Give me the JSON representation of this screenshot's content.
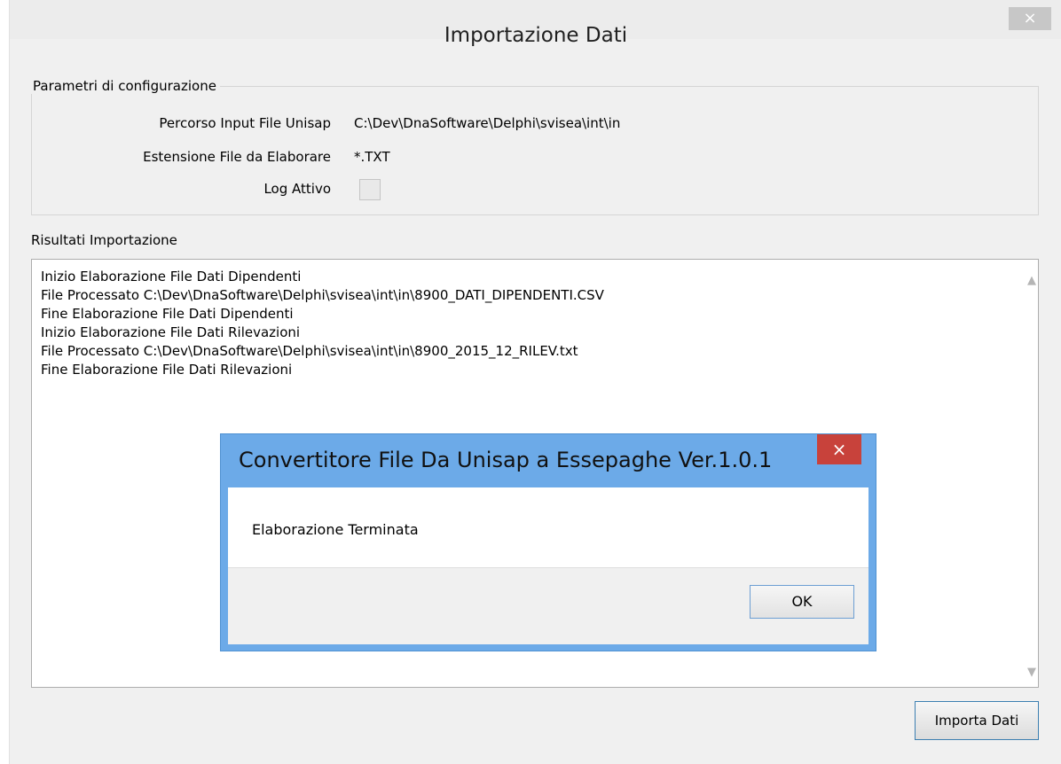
{
  "window": {
    "title": "Importazione Dati",
    "close_glyph": "×"
  },
  "config": {
    "group_title": "Parametri di configurazione",
    "input_path_label": "Percorso Input File Unisap",
    "input_path_value": "C:\\Dev\\DnaSoftware\\Delphi\\svisea\\int\\in",
    "extension_label": "Estensione File da Elaborare",
    "extension_value": "*.TXT",
    "log_label": "Log Attivo",
    "log_checked": false
  },
  "results": {
    "label": "Risultati Importazione",
    "lines": [
      "Inizio Elaborazione File Dati Dipendenti",
      "File Processato C:\\Dev\\DnaSoftware\\Delphi\\svisea\\int\\in\\8900_DATI_DIPENDENTI.CSV",
      "Fine Elaborazione File Dati Dipendenti",
      "Inizio Elaborazione File Dati Rilevazioni",
      "File Processato C:\\Dev\\DnaSoftware\\Delphi\\svisea\\int\\in\\8900_2015_12_RILEV.txt",
      "Fine Elaborazione File Dati Rilevazioni"
    ]
  },
  "actions": {
    "import_label": "Importa Dati"
  },
  "dialog": {
    "title": "Convertitore File Da Unisap a Essepaghe Ver.1.0.1",
    "close_glyph": "×",
    "message": "Elaborazione Terminata",
    "ok_label": "OK"
  },
  "colors": {
    "dialog_frame": "#6caae8",
    "close_button": "#c8423b",
    "window_bg": "#f0f0f0"
  }
}
